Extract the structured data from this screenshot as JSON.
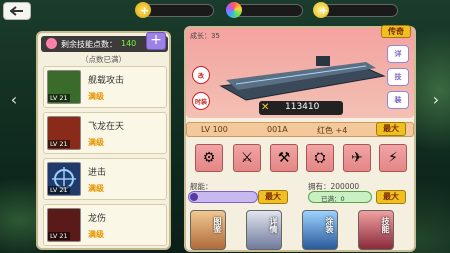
{
  "top_bar": {
    "resources": [
      {
        "icon": "gold-coin-icon"
      },
      {
        "icon": "crystal-icon"
      },
      {
        "icon": "star-points-icon"
      }
    ],
    "plus": "+"
  },
  "skills": {
    "points_label": "剩余技能点数：",
    "points_value": "140",
    "add": "+",
    "max_note": "（点数已满）",
    "items": [
      {
        "name": "舰载攻击",
        "lv": "LV 21",
        "status": "满级",
        "color": "#3a6b2a"
      },
      {
        "name": "飞龙在天",
        "lv": "LV 21",
        "status": "满级",
        "color": "#8a2a1a"
      },
      {
        "name": "进击",
        "lv": "LV 21",
        "status": "满级",
        "color": "#1f3a6b"
      },
      {
        "name": "龙伤",
        "lv": "LV 21",
        "status": "满级",
        "color": "#5a1a1a"
      }
    ]
  },
  "ship": {
    "growth": "成长：35",
    "legend": "传奇",
    "tags": [
      "改",
      "时装"
    ],
    "side_tags": [
      "详",
      "技",
      "装"
    ],
    "power": "113410",
    "level": "LV 100",
    "code": "001A",
    "grade": "红色 +4",
    "max": "最大"
  },
  "bars": {
    "left_label": "舰能：",
    "left_max": "最大",
    "right_label": "拥有：200000",
    "right_sub": "已满：0",
    "right_max": "最大"
  },
  "bottom_buttons": [
    {
      "label": "图鉴"
    },
    {
      "label": "详情"
    },
    {
      "label": "涂装"
    },
    {
      "label": "技能"
    }
  ]
}
